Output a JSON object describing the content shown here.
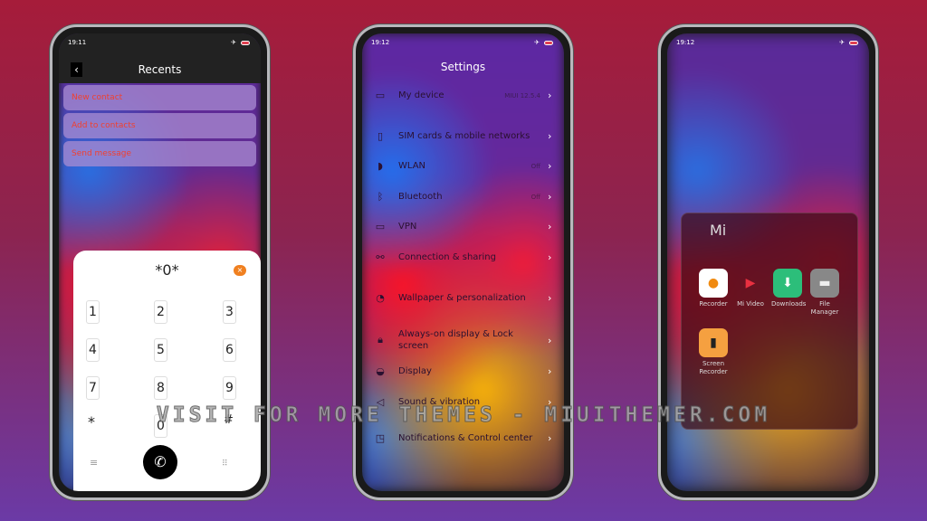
{
  "recents": {
    "time": "19:11",
    "title": "Recents",
    "menu": [
      "New contact",
      "Add to contacts",
      "Send message"
    ],
    "dialer": {
      "number": "*0*",
      "keys": [
        "1",
        "2",
        "3",
        "4",
        "5",
        "6",
        "7",
        "8",
        "9",
        "*",
        "0",
        "#"
      ]
    }
  },
  "settings": {
    "time": "19:12",
    "title": "Settings",
    "items": [
      {
        "label": "My device",
        "value": "MIUI 12.5.4",
        "icon": "phone-icon"
      },
      {
        "label": "SIM cards & mobile networks",
        "value": "",
        "icon": "sim-icon"
      },
      {
        "label": "WLAN",
        "value": "Off",
        "icon": "wifi-icon"
      },
      {
        "label": "Bluetooth",
        "value": "Off",
        "icon": "bluetooth-icon"
      },
      {
        "label": "VPN",
        "value": "",
        "icon": "vpn-icon"
      },
      {
        "label": "Connection & sharing",
        "value": "",
        "icon": "share-icon"
      },
      {
        "label": "Wallpaper & personalization",
        "value": "",
        "icon": "wallpaper-icon"
      },
      {
        "label": "Always-on display & Lock screen",
        "value": "",
        "icon": "lock-icon"
      },
      {
        "label": "Display",
        "value": "",
        "icon": "display-icon"
      },
      {
        "label": "Sound & vibration",
        "value": "",
        "icon": "sound-icon"
      },
      {
        "label": "Notifications & Control center",
        "value": "",
        "icon": "notification-icon"
      }
    ]
  },
  "home": {
    "time": "19:12",
    "folder": {
      "name": "Mi",
      "apps": [
        "Recorder",
        "Mi Video",
        "Downloads",
        "File Manager",
        "Screen Recorder"
      ]
    }
  },
  "watermark": "VISIT FOR MORE THEMES - MIUITHEMER.COM"
}
